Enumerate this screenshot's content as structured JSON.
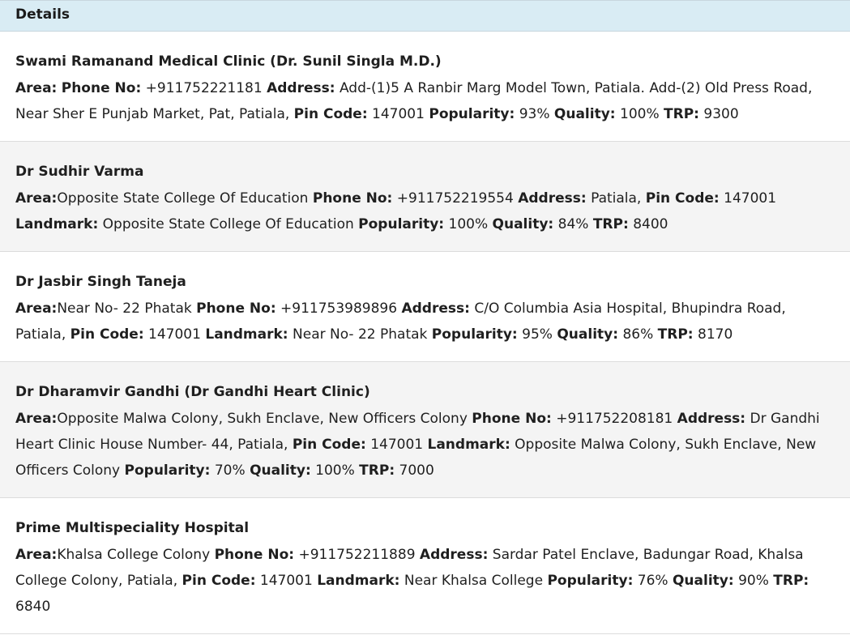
{
  "header": {
    "title": "Details"
  },
  "labels": {
    "area": "Area:",
    "phone": "Phone No:",
    "address": "Address:",
    "pin": "Pin Code:",
    "landmark": "Landmark:",
    "popularity": "Popularity:",
    "quality": "Quality:",
    "trp": "TRP:"
  },
  "entries": [
    {
      "name": "Swami Ramanand Medical Clinic (Dr. Sunil Singla M.D.)",
      "area": "",
      "phone": "+911752221181",
      "address": "Add-(1)5 A Ranbir Marg Model Town, Patiala. Add-(2) Old Press Road, Near Sher E Punjab Market, Pat, Patiala,",
      "pin": "147001",
      "landmark": null,
      "popularity": "93%",
      "quality": "100%",
      "trp": "9300"
    },
    {
      "name": "Dr Sudhir Varma",
      "area": "Opposite State College Of Education",
      "phone": "+911752219554",
      "address": "Patiala,",
      "pin": "147001",
      "landmark": "Opposite State College Of Education",
      "popularity": "100%",
      "quality": "84%",
      "trp": "8400"
    },
    {
      "name": "Dr Jasbir Singh Taneja",
      "area": "Near No- 22 Phatak",
      "phone": "+911753989896",
      "address": "C/O Columbia Asia Hospital, Bhupindra Road, Patiala,",
      "pin": "147001",
      "landmark": "Near No- 22 Phatak",
      "popularity": "95%",
      "quality": "86%",
      "trp": "8170"
    },
    {
      "name": "Dr Dharamvir Gandhi (Dr Gandhi Heart Clinic)",
      "area": "Opposite Malwa Colony, Sukh Enclave, New Officers Colony",
      "phone": "+911752208181",
      "address": "Dr Gandhi Heart Clinic House Number- 44, Patiala,",
      "pin": "147001",
      "landmark": "Opposite Malwa Colony, Sukh Enclave, New Officers Colony",
      "popularity": "70%",
      "quality": "100%",
      "trp": "7000"
    },
    {
      "name": "Prime Multispeciality Hospital",
      "area": "Khalsa College Colony",
      "phone": "+911752211889",
      "address": "Sardar Patel Enclave, Badungar Road, Khalsa College Colony, Patiala,",
      "pin": "147001",
      "landmark": "Near Khalsa College",
      "popularity": "76%",
      "quality": "90%",
      "trp": "6840"
    }
  ]
}
